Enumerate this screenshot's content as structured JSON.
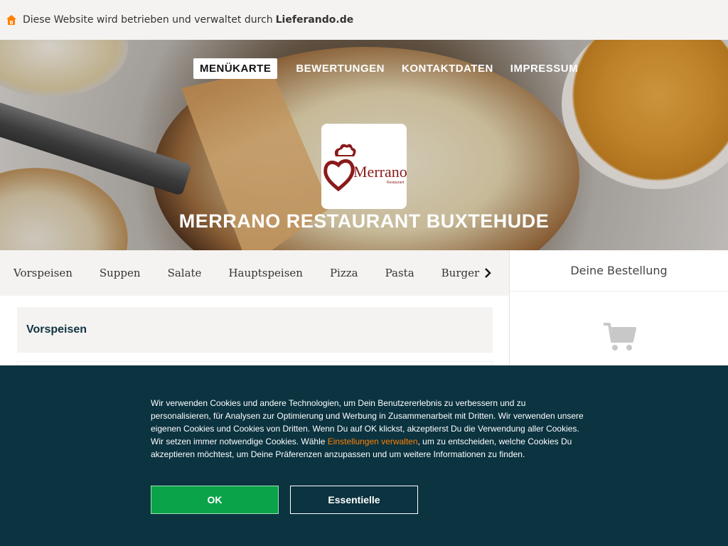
{
  "notice": {
    "text": "Diese Website wird betrieben und verwaltet durch",
    "brand": "Lieferando.de",
    "icon": "house-icon"
  },
  "nav": {
    "items": [
      "MENÜKARTE",
      "BEWERTUNGEN",
      "KONTAKTDATEN",
      "IMPRESSUM"
    ],
    "active": "MENÜKARTE"
  },
  "restaurant": {
    "logo_text": "Merrano",
    "logo_subtext": "Restaurant",
    "title": "MERRANO RESTAURANT BUXTEHUDE"
  },
  "categories": [
    "Vorspeisen",
    "Suppen",
    "Salate",
    "Hauptspeisen",
    "Pizza",
    "Pasta",
    "Burger"
  ],
  "order": {
    "title": "Deine Bestellung",
    "icon": "cart-icon"
  },
  "menu": {
    "section_title": "Vorspeisen"
  },
  "cookie": {
    "text_before_link": "Wir verwenden Cookies und andere Technologien, um Dein Benutzererlebnis zu verbessern und zu personalisieren, für Analysen zur Optimierung und Werbung in Zusammenarbeit mit Dritten. Wir verwenden unsere eigenen Cookies und Cookies von Dritten. Wenn Du auf OK klickst, akzeptierst Du die Verwendung aller Cookies. Wir setzen immer notwendige Cookies. Wähle ",
    "link_text": "Einstellungen verwalten",
    "text_after_link": ", um zu entscheiden, welche Cookies Du akzeptieren möchtest, um Deine Präferenzen anzupassen und um weitere Informationen zu finden.",
    "ok_label": "OK",
    "essential_label": "Essentielle"
  },
  "colors": {
    "brand_orange": "#ff8000",
    "banner_bg": "#0b3340",
    "ok_green": "#0ba34a",
    "logo_red": "#8a1b1b"
  }
}
